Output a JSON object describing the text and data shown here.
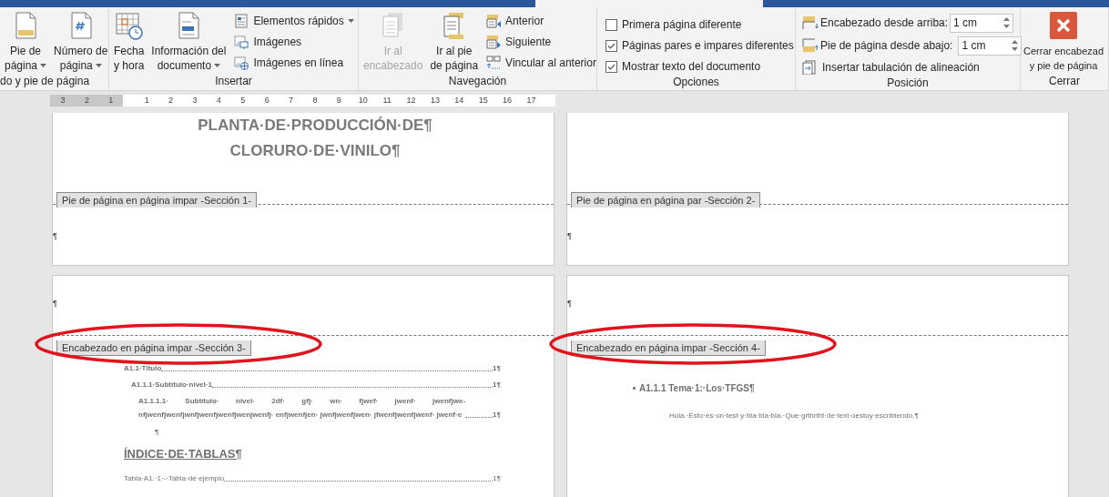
{
  "ribbon": {
    "groups": [
      {
        "label": "do y pie de página",
        "items": [
          {
            "kind": "large",
            "lines": [
              "Pie de",
              "página"
            ],
            "dropdown": true,
            "disabled": false
          },
          {
            "kind": "large",
            "lines": [
              "Número de",
              "página"
            ],
            "dropdown": true,
            "disabled": false
          }
        ]
      },
      {
        "label": "Insertar",
        "items": [
          {
            "kind": "large",
            "lines": [
              "Fecha",
              "y hora"
            ],
            "dropdown": false,
            "disabled": false
          },
          {
            "kind": "large",
            "lines": [
              "Información del",
              "documento"
            ],
            "dropdown": true,
            "disabled": false
          },
          {
            "kind": "stack",
            "items": [
              {
                "label": "Elementos rápidos",
                "dropdown": true
              },
              {
                "label": "Imágenes",
                "dropdown": false
              },
              {
                "label": "Imágenes en línea",
                "dropdown": false
              }
            ]
          }
        ]
      },
      {
        "label": "Navegación",
        "items": [
          {
            "kind": "large",
            "lines": [
              "Ir al",
              "encabezado"
            ],
            "dropdown": false,
            "disabled": true
          },
          {
            "kind": "large",
            "lines": [
              "Ir al pie",
              "de página"
            ],
            "dropdown": false,
            "disabled": false
          },
          {
            "kind": "stack",
            "items": [
              {
                "label": "Anterior",
                "dropdown": false
              },
              {
                "label": "Siguiente",
                "dropdown": false
              },
              {
                "label": "Vincular al anterior",
                "dropdown": false
              }
            ]
          }
        ]
      },
      {
        "label": "Opciones",
        "items": [
          {
            "kind": "checks",
            "items": [
              {
                "label": "Primera página diferente",
                "checked": false
              },
              {
                "label": "Páginas pares e impares diferentes",
                "checked": true
              },
              {
                "label": "Mostrar texto del documento",
                "checked": true
              }
            ]
          }
        ]
      },
      {
        "label": "Posición",
        "items": [
          {
            "kind": "position",
            "spinners": [
              {
                "label": "Encabezado desde arriba:",
                "value": "1 cm"
              },
              {
                "label": "Pie de página desde abajo:",
                "value": "1 cm"
              }
            ],
            "button": "Insertar tabulación de alineación"
          }
        ]
      },
      {
        "label": "Cerrar",
        "items": [
          {
            "kind": "close",
            "lines": [
              "Cerrar encabezad",
              "y pie de página"
            ]
          }
        ]
      }
    ]
  },
  "ruler": {
    "left_labels": [
      "3",
      "2",
      "1"
    ],
    "right_labels": [
      "1",
      "2",
      "3",
      "4",
      "5",
      "6",
      "7",
      "8",
      "9",
      "10",
      "11",
      "12",
      "13",
      "14",
      "15",
      "16",
      "17"
    ]
  },
  "pages": [
    {
      "body": [
        {
          "kind": "title",
          "text": "PLANTA·DE·PRODUCCIÓN·DE¶"
        },
        {
          "kind": "title",
          "text": "CLORURO·DE·VINILO¶"
        }
      ],
      "footer": {
        "tag": "Pie de página en página impar -Sección 1-",
        "text": "¶"
      }
    },
    {
      "footer": {
        "tag": "Pie de página en página par -Sección 2-",
        "text": "¶"
      }
    },
    {
      "header": {
        "text": "¶",
        "tag": "Encabezado en página impar -Sección 3-",
        "circled": true
      },
      "body": [
        {
          "kind": "toc1",
          "text": "A1.1·Título",
          "page": "1¶"
        },
        {
          "kind": "toc2",
          "text": "A1.1.1·Subtítulo·nivel·1",
          "page": "1¶"
        },
        {
          "kind": "toc3",
          "text": "A1.1.1.1· Subtítulo· nivel· 2df· gfj· wn· fjwef· jwenf· jwenfjwe-nfjwenfjwenfjwnfjwenfjwenfjwenjwenfj· enfjwenfjen· jwnfjwenfjwen· jfwenfjwenfjwenf· jwenf·e",
          "page": "1¶"
        },
        {
          "kind": "mark",
          "text": "¶"
        },
        {
          "kind": "heading",
          "text": "ÍNDICE·DE·TABLAS¶"
        },
        {
          "kind": "table",
          "text": "Tabla·A1.·1·-·Tabla·de·ejemplo",
          "page": "1¶"
        }
      ]
    },
    {
      "header": {
        "text": "¶",
        "tag": "Encabezado en página impar -Sección 4-",
        "circled": true
      },
      "body": [
        {
          "kind": "bullet",
          "text": "A1.1.1 Tema·1:·Los·TFGS¶"
        },
        {
          "kind": "paragraph",
          "text": "Hola.·Esto·es·un·test·y·bla·bla·bla.·Que·grthrtht·de·text·oestoy·escribiendo.¶"
        }
      ]
    }
  ]
}
